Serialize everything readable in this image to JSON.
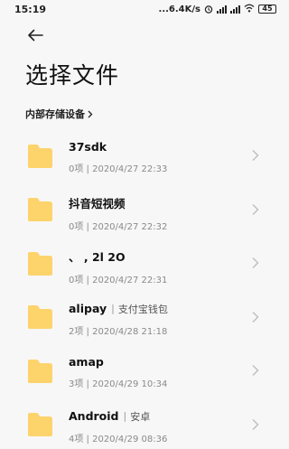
{
  "status_bar": {
    "time": "15:19",
    "network_speed": "...6.4K/s",
    "battery": "45"
  },
  "header": {
    "back_icon": "arrow-left-icon",
    "title": "选择文件",
    "breadcrumb": "内部存储设备"
  },
  "colors": {
    "folder": "#fdd36b",
    "background": "#f7f7f7"
  },
  "files": [
    {
      "name": "37sdk",
      "subtitle": "",
      "meta": "0项 | 2020/4/27 22:33"
    },
    {
      "name": "抖音短视频",
      "subtitle": "",
      "meta": "0项 | 2020/4/27 22:32"
    },
    {
      "name": "、 ,  2l 2O",
      "subtitle": "",
      "meta": "0项 | 2020/4/27 22:31"
    },
    {
      "name": "alipay",
      "subtitle": "支付宝钱包",
      "meta": "2项 | 2020/4/28 21:18"
    },
    {
      "name": "amap",
      "subtitle": "",
      "meta": "3项 | 2020/4/29 10:34"
    },
    {
      "name": "Android",
      "subtitle": "安卓",
      "meta": "4项 | 2020/4/29 08:36"
    }
  ]
}
